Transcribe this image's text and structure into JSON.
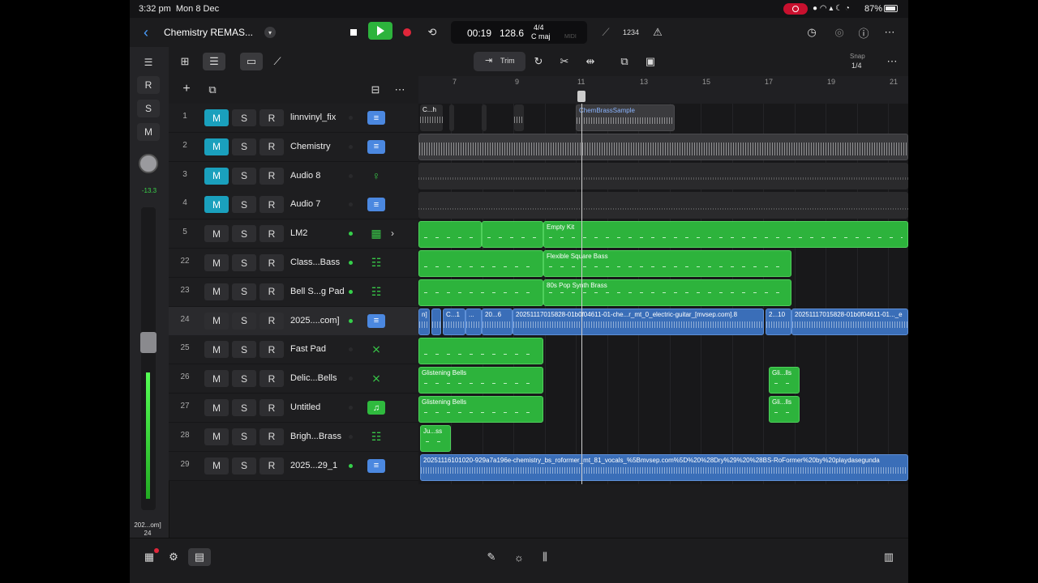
{
  "status_bar": {
    "time": "3:32 pm",
    "date": "Mon 8 Dec",
    "battery": "87%"
  },
  "top_bar": {
    "project_title": "Chemistry REMAS...",
    "lcd": {
      "position": "00:19",
      "tempo": "128.6",
      "signature": "4/4",
      "key": "C maj",
      "midi": "MIDI"
    },
    "count_in": "1234"
  },
  "toolbar2": {
    "trim_label": "Trim",
    "snap_label": "Snap",
    "snap_value": "1/4"
  },
  "left_strip": {
    "volume": "-13.3",
    "footer_name": "202...om]",
    "footer_num": "24"
  },
  "ruler": {
    "bars": [
      "7",
      "9",
      "11",
      "13",
      "15",
      "17",
      "19",
      "21"
    ]
  },
  "tracks": [
    {
      "num": "1",
      "name": "linnvinyl_fix",
      "muted": true,
      "dot": false,
      "icon": "audio-icon",
      "glyph": "≡"
    },
    {
      "num": "2",
      "name": "Chemistry",
      "muted": true,
      "dot": false,
      "icon": "audio-icon",
      "glyph": "≡"
    },
    {
      "num": "3",
      "name": "Audio 8",
      "muted": true,
      "dot": false,
      "icon": "guitar-icon",
      "glyph": "♀"
    },
    {
      "num": "4",
      "name": "Audio 7",
      "muted": true,
      "dot": false,
      "icon": "audio-icon",
      "glyph": "≡"
    },
    {
      "num": "5",
      "name": "LM2",
      "muted": false,
      "dot": true,
      "icon": "drum-machine-icon",
      "glyph": "▦"
    },
    {
      "num": "22",
      "name": "Class...Bass",
      "muted": false,
      "dot": true,
      "icon": "keyboard-icon",
      "glyph": "☷"
    },
    {
      "num": "23",
      "name": "Bell S...g Pad",
      "muted": false,
      "dot": true,
      "icon": "keyboard-icon",
      "glyph": "☷"
    },
    {
      "num": "24",
      "name": "2025....com]",
      "muted": false,
      "dot": true,
      "icon": "audio-icon",
      "glyph": "≡"
    },
    {
      "num": "25",
      "name": "Fast Pad",
      "muted": false,
      "dot": false,
      "icon": "keyboard-stand-icon",
      "glyph": "⨯"
    },
    {
      "num": "26",
      "name": "Delic...Bells",
      "muted": false,
      "dot": false,
      "icon": "keyboard-stand-icon",
      "glyph": "⨯"
    },
    {
      "num": "27",
      "name": "Untitled",
      "muted": false,
      "dot": false,
      "icon": "music-note-icon",
      "glyph": "♫"
    },
    {
      "num": "28",
      "name": "Brigh...Brass",
      "muted": false,
      "dot": false,
      "icon": "synth-icon",
      "glyph": "☷"
    },
    {
      "num": "29",
      "name": "2025...29_1",
      "muted": false,
      "dot": true,
      "icon": "audio-icon",
      "glyph": "≡"
    }
  ],
  "regions": {
    "r1a": "C...h",
    "r1b": "ChemBrassSample",
    "r5": "Empty Kit",
    "r22": "Flexible Square Bass",
    "r23": "80s Pop Synth Brass",
    "r24a": "n]",
    "r24b": "C...1",
    "r24c": "...",
    "r24d": "20...6",
    "r24e": "20251117015828-01b0f04611-01-che...r_mt_0_electric-guitar_[mvsep.com].8",
    "r24f": "2...10",
    "r24g": "20251117015828-01b0f04611-01..._e",
    "r26a": "Glistening Bells",
    "r26b": "Gli...lls",
    "r27a": "Glistening Bells",
    "r27b": "Gli...lls",
    "r28": "Ju...ss",
    "r29": "20251116101020-929a7a196e-chemistry_bs_roformer_mt_81_vocals_%5Bmvsep.com%5D%20%28Dry%29%20%28BS-RoFormer%20by%20playdasegunda"
  }
}
